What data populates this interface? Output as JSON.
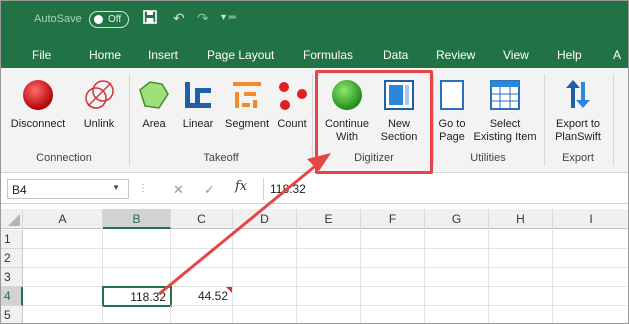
{
  "titlebar": {
    "autosave_label": "AutoSave",
    "autosave_state": "Off"
  },
  "tabs": [
    "File",
    "Home",
    "Insert",
    "Page Layout",
    "Formulas",
    "Data",
    "Review",
    "View",
    "Help",
    "A"
  ],
  "ribbon": {
    "connection": {
      "label": "Connection",
      "disconnect": "Disconnect",
      "unlink": "Unlink"
    },
    "takeoff": {
      "label": "Takeoff",
      "area": "Area",
      "linear": "Linear",
      "segment": "Segment",
      "count": "Count"
    },
    "digitizer": {
      "label": "Digitizer",
      "continue_line1": "Continue",
      "continue_line2": "With",
      "new_line1": "New",
      "new_line2": "Section"
    },
    "utilities": {
      "label": "Utilities",
      "goto_line1": "Go to",
      "goto_line2": "Page",
      "select_line1": "Select",
      "select_line2": "Existing Item"
    },
    "export": {
      "label": "Export",
      "export_line1": "Export to",
      "export_line2": "PlanSwift"
    }
  },
  "formula_bar": {
    "name_box": "B4",
    "fx_symbol": "fx",
    "value": "118.32"
  },
  "grid": {
    "columns": [
      "A",
      "B",
      "C",
      "D",
      "E",
      "F",
      "G",
      "H",
      "I"
    ],
    "rows": [
      "1",
      "2",
      "3",
      "4",
      "5"
    ],
    "selected_cell": "B4",
    "cells": {
      "B4": "118.32",
      "C4": "44.52"
    }
  },
  "colors": {
    "excel_green": "#217346",
    "highlight_red": "#e64545"
  }
}
